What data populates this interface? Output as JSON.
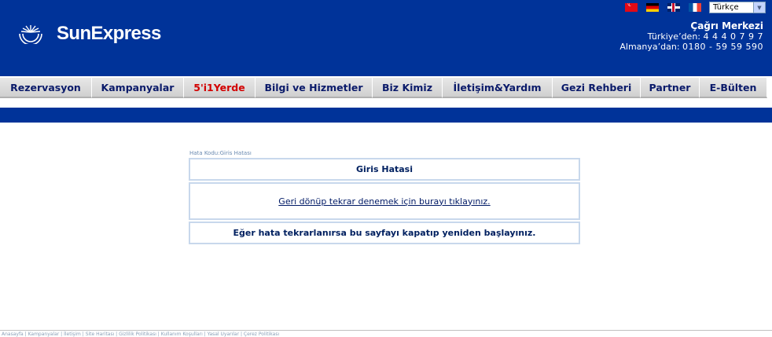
{
  "brand": {
    "name": "SunExpress"
  },
  "language": {
    "flags": [
      "turkish-flag-icon",
      "german-flag-icon",
      "uk-flag-icon",
      "french-flag-icon"
    ],
    "selected": "Türkçe"
  },
  "call_center": {
    "title": "Çağrı Merkezi",
    "turkey_label": "Türkiye’den:",
    "turkey_number": "4 4 4   0 7 9 7",
    "germany_label": "Almanya’dan:",
    "germany_number": "0180 - 59 59 590"
  },
  "nav": {
    "items": [
      {
        "label": "Rezervasyon"
      },
      {
        "label": "Kampanyalar"
      },
      {
        "label": "5'i1Yerde"
      },
      {
        "label": "Bilgi ve Hizmetler"
      },
      {
        "label": "Biz Kimiz"
      },
      {
        "label": "İletişim&Yardım"
      },
      {
        "label": "Gezi Rehberi"
      },
      {
        "label": "Partner"
      },
      {
        "label": "E-Bülten"
      }
    ]
  },
  "error": {
    "code_label": "Hata Kodu:Giris Hatası",
    "title": "Giris Hatasi",
    "retry_link": "Geri dönüp tekrar denemek için burayı tıklayınız.",
    "restart_text": "Eğer hata tekrarlanırsa bu sayfayı kapatıp yeniden başlayınız."
  },
  "footer": {
    "text": "Anasayfa | Kampanyalar | İletişim | Site Haritası | Gizlilik Politikası | Kullanım Koşulları | Yasal Uyarılar | Çerez Politikası"
  },
  "colors": {
    "header_blue": "#003399",
    "nav_hot": "#d20000"
  }
}
